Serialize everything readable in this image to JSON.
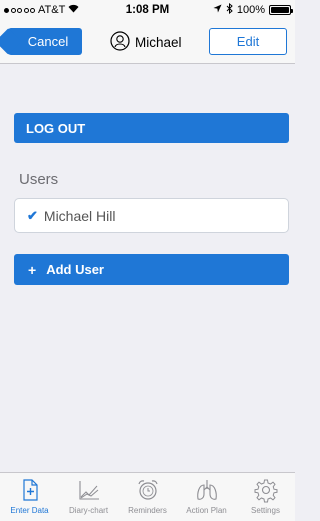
{
  "status_bar": {
    "carrier": "AT&T",
    "time": "1:08 PM",
    "battery": "100%",
    "signal_dots_filled": 1,
    "signal_dots_total": 5,
    "battery_level": 1.0
  },
  "nav": {
    "cancel_label": "Cancel",
    "title": "Michael",
    "edit_label": "Edit"
  },
  "logout_label": "LOG OUT",
  "users": {
    "heading": "Users",
    "items": [
      {
        "name": "Michael Hill",
        "selected": true
      }
    ],
    "add_label": "Add User"
  },
  "tabs": [
    {
      "label": "Enter Data",
      "icon": "enter-data-icon",
      "active": true
    },
    {
      "label": "Diary-chart",
      "icon": "diary-chart-icon",
      "active": false
    },
    {
      "label": "Reminders",
      "icon": "alarm-clock-icon",
      "active": false
    },
    {
      "label": "Action Plan",
      "icon": "lungs-icon",
      "active": false
    },
    {
      "label": "Settings",
      "icon": "gear-icon",
      "active": false
    }
  ],
  "colors": {
    "accent": "#1f77d6",
    "background": "#efeff4",
    "inactive": "#8e8e93"
  }
}
